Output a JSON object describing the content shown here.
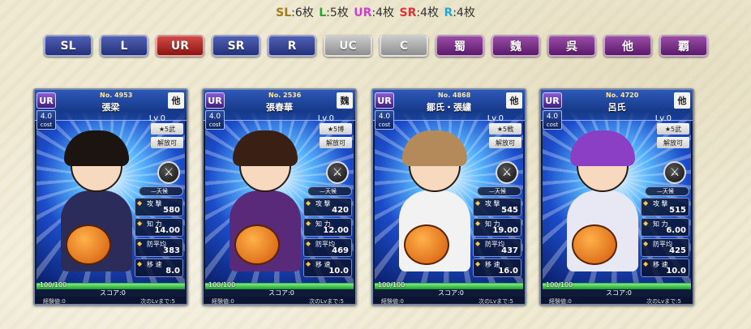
{
  "counts": [
    {
      "key": "SL",
      "value": ":6枚",
      "color": "#a57a1e"
    },
    {
      "key": "L",
      "value": ":5枚",
      "color": "#2aa52a"
    },
    {
      "key": "UR",
      "value": ":4枚",
      "color": "#d23ad6"
    },
    {
      "key": "SR",
      "value": ":4枚",
      "color": "#d9333a"
    },
    {
      "key": "R",
      "value": ":4枚",
      "color": "#1fa8d8"
    }
  ],
  "filters": [
    {
      "label": "SL",
      "style": "blue"
    },
    {
      "label": "L",
      "style": "blue"
    },
    {
      "label": "UR",
      "style": "red"
    },
    {
      "label": "SR",
      "style": "blue"
    },
    {
      "label": "R",
      "style": "blue"
    },
    {
      "label": "UC",
      "style": "gray"
    },
    {
      "label": "C",
      "style": "gray"
    },
    {
      "label": "蜀",
      "style": "purple"
    },
    {
      "label": "魏",
      "style": "purple"
    },
    {
      "label": "呉",
      "style": "purple"
    },
    {
      "label": "他",
      "style": "purple"
    },
    {
      "label": "覇",
      "style": "purple"
    }
  ],
  "cards": [
    {
      "rarity": "UR",
      "cost": "4.0",
      "cost_label": "cost",
      "number": "4953",
      "name": "張梁",
      "faction": "他",
      "level": "Lv.0",
      "tag1": "★5武",
      "tag2": "解放可",
      "skill": "天候",
      "stats": [
        {
          "label": "攻 撃",
          "value": "580"
        },
        {
          "label": "知 力",
          "value": "14.00"
        },
        {
          "label": "防平均",
          "value": "383"
        },
        {
          "label": "移 速",
          "value": "8.0"
        }
      ],
      "hp": "100/100",
      "score": "スコア:0",
      "exp": "経験値:0",
      "next": "次のLvまで:5",
      "hair": "#1c1410",
      "outfit": "#2c2c5a",
      "hat": "#f0c21a"
    },
    {
      "rarity": "UR",
      "cost": "4.0",
      "cost_label": "cost",
      "number": "2536",
      "name": "張春華",
      "faction": "魏",
      "level": "Lv.0",
      "tag1": "★5博",
      "tag2": "解放可",
      "skill": "天候",
      "stats": [
        {
          "label": "攻 撃",
          "value": "420"
        },
        {
          "label": "知 力",
          "value": "12.00"
        },
        {
          "label": "防平均",
          "value": "469"
        },
        {
          "label": "移 速",
          "value": "10.0"
        }
      ],
      "hp": "100/100",
      "score": "スコア:0",
      "exp": "経験値:0",
      "next": "次のLvまで:5",
      "hair": "#3a1f14",
      "outfit": "#5a2a7a",
      "hat": "#2a1838"
    },
    {
      "rarity": "UR",
      "cost": "4.0",
      "cost_label": "cost",
      "number": "4868",
      "name": "鄒氏・張繍",
      "faction": "他",
      "level": "Lv.0",
      "tag1": "★5戦",
      "tag2": "解放可",
      "skill": "天候",
      "stats": [
        {
          "label": "攻 撃",
          "value": "545"
        },
        {
          "label": "知 力",
          "value": "19.00"
        },
        {
          "label": "防平均",
          "value": "437"
        },
        {
          "label": "移 速",
          "value": "16.0"
        }
      ],
      "hp": "100/100",
      "score": "スコア:0",
      "exp": "経験値:0",
      "next": "次のLvまで:5",
      "hair": "#b58a5a",
      "outfit": "#f2f2f2",
      "hat": "#ffffff"
    },
    {
      "rarity": "UR",
      "cost": "4.0",
      "cost_label": "cost",
      "number": "4720",
      "name": "呂氏",
      "faction": "他",
      "level": "Lv.0",
      "tag1": "★5武",
      "tag2": "解放可",
      "skill": "天候",
      "stats": [
        {
          "label": "攻 撃",
          "value": "515"
        },
        {
          "label": "知 力",
          "value": "6.00"
        },
        {
          "label": "防平均",
          "value": "425"
        },
        {
          "label": "移 速",
          "value": "10.0"
        }
      ],
      "hp": "100/100",
      "score": "スコア:0",
      "exp": "経験値:0",
      "next": "次のLvまで:5",
      "hair": "#8a3fc4",
      "outfit": "#e8e8f4",
      "hat": "#f0f0f6"
    }
  ]
}
